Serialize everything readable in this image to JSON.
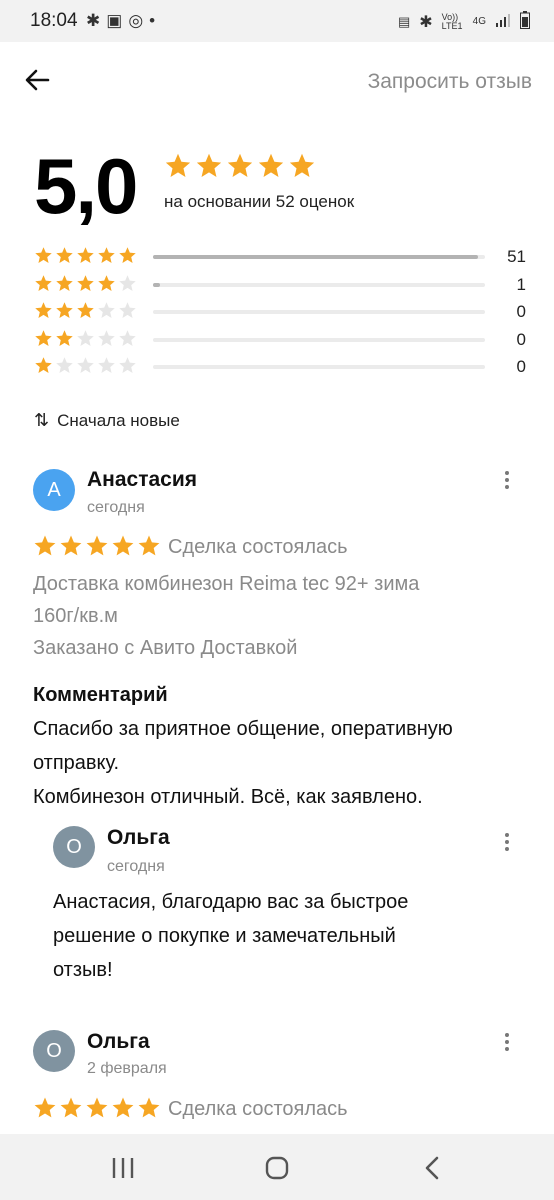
{
  "status_bar": {
    "time": "18:04",
    "left_icons": [
      "bluetooth-icon",
      "image-icon",
      "check-circle-icon",
      "dot-icon"
    ],
    "right_icons": [
      "battery-saver-icon",
      "bluetooth-icon",
      "volte-icon",
      "signal-4g-icon",
      "signal-bars-icon",
      "battery-icon"
    ],
    "volte": "Vo)) LTE1",
    "network": "4G"
  },
  "header": {
    "back_icon": "arrow-left-icon",
    "request_review": "Запросить отзыв"
  },
  "summary": {
    "rating": "5,0",
    "stars": 5,
    "based_on": "на основании 52 оценок"
  },
  "colors": {
    "star_filled": "#f6a623",
    "star_empty": "#e6e6e6",
    "bar_fill": "#b3b3b3",
    "bar_track": "#ebebeb",
    "avatar_blue": "#4aa3f0",
    "avatar_gray": "#8093a0"
  },
  "breakdown": [
    {
      "stars": 5,
      "count": "51",
      "fraction": 0.98
    },
    {
      "stars": 4,
      "count": "1",
      "fraction": 0.02
    },
    {
      "stars": 3,
      "count": "0",
      "fraction": 0
    },
    {
      "stars": 2,
      "count": "0",
      "fraction": 0
    },
    {
      "stars": 1,
      "count": "0",
      "fraction": 0
    }
  ],
  "sort": {
    "icon": "sort-arrows-icon",
    "label": "Сначала новые"
  },
  "reviews": [
    {
      "avatar_letter": "А",
      "author": "Анастасия",
      "date": "сегодня",
      "stars": 5,
      "deal": "Сделка состоялась",
      "item_line1": "Доставка комбинезон Reima tec 92+ зима",
      "item_line2": "160г/кв.м",
      "delivery": "Заказано с Авито Доставкой",
      "comment_title": "Комментарий",
      "comment_line1": "Спасибо за приятное общение, оперативную",
      "comment_line2": "отправку.",
      "comment_line3": "Комбинезон отличный. Всё, как заявлено.",
      "reply": {
        "avatar_letter": "О",
        "author": "Ольга",
        "date": "сегодня",
        "text_line1": "Анастасия, благодарю вас за быстрое",
        "text_line2": "решение о покупке и замечательный",
        "text_line3": "отзыв!"
      }
    },
    {
      "avatar_letter": "О",
      "author": "Ольга",
      "date": "2 февраля",
      "stars": 5,
      "deal": "Сделка состоялась"
    }
  ],
  "nav_bar": {
    "recents_icon": "recents-icon",
    "home_icon": "home-icon",
    "back_icon": "nav-back-icon"
  }
}
